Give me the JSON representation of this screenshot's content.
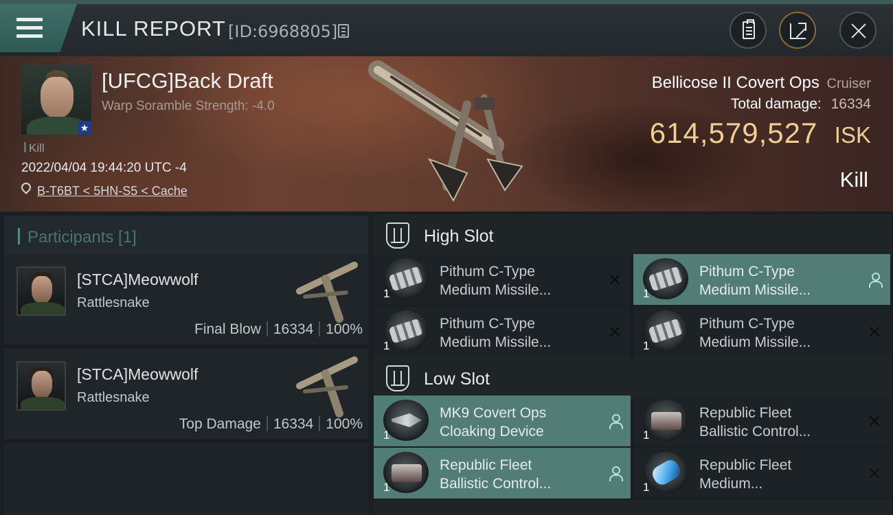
{
  "header": {
    "title": "KILL REPORT",
    "report_id": "[ID:6968805]"
  },
  "victim": {
    "name": "[UFCG]Back Draft",
    "warp_scramble": "Warp Soramble Strength: -4.0",
    "tag": "Kill",
    "timestamp": "2022/04/04 19:44:20 UTC -4",
    "location": "B-T6BT < 5HN-S5 < Cache",
    "ship_name": "Bellicose II Covert Ops",
    "ship_class": "Cruiser",
    "damage_label": "Total damage:",
    "damage_value": "16334",
    "isk_value": "614,579,527",
    "isk_unit": "ISK",
    "result": "Kill"
  },
  "participants": {
    "title": "Participants [1]",
    "items": [
      {
        "name": "[STCA]Meowwolf",
        "ship": "Rattlesnake",
        "role": "Final Blow",
        "damage": "16334",
        "percent": "100%"
      },
      {
        "name": "[STCA]Meowwolf",
        "ship": "Rattlesnake",
        "role": "Top Damage",
        "damage": "16334",
        "percent": "100%"
      }
    ]
  },
  "fitting": {
    "high_slot": {
      "title": "High Slot",
      "modules": [
        {
          "qty": "1",
          "line1": "Pithum C-Type",
          "line2": "Medium Missile...",
          "status": "destroyed",
          "icon": "launcher-icon"
        },
        {
          "qty": "1",
          "line1": "Pithum C-Type",
          "line2": "Medium Missile...",
          "status": "dropped",
          "icon": "launcher-icon"
        },
        {
          "qty": "1",
          "line1": "Pithum C-Type",
          "line2": "Medium Missile...",
          "status": "destroyed",
          "icon": "launcher-icon"
        },
        {
          "qty": "1",
          "line1": "Pithum C-Type",
          "line2": "Medium Missile...",
          "status": "destroyed",
          "icon": "launcher-icon"
        }
      ]
    },
    "low_slot": {
      "title": "Low Slot",
      "modules": [
        {
          "qty": "1",
          "line1": "MK9 Covert Ops",
          "line2": "Cloaking Device",
          "status": "dropped",
          "icon": "cloak-icon"
        },
        {
          "qty": "1",
          "line1": "Republic Fleet",
          "line2": "Ballistic Control...",
          "status": "destroyed",
          "icon": "bcs-icon"
        },
        {
          "qty": "1",
          "line1": "Republic Fleet",
          "line2": "Ballistic Control...",
          "status": "dropped",
          "icon": "bcs-icon"
        },
        {
          "qty": "1",
          "line1": "Republic Fleet",
          "line2": "Medium...",
          "status": "destroyed",
          "icon": "ammo-icon"
        }
      ]
    }
  },
  "colors": {
    "accent": "#527c76",
    "isk": "#efcf92",
    "panel": "#1d2226"
  }
}
